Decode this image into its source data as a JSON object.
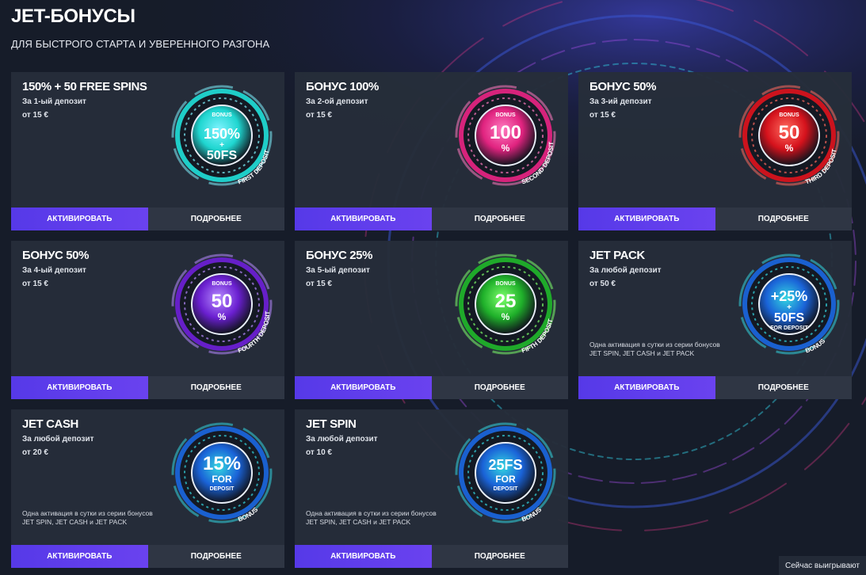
{
  "header": {
    "title": "JET-БОНУСЫ",
    "subtitle": "ДЛЯ БЫСТРОГО СТАРТА И УВЕРЕННОГО РАЗГОНА"
  },
  "cards": [
    {
      "title": "150% + 50 FREE SPINS",
      "deposit": "За 1-ый депозит",
      "min": "от 15 €",
      "note": "",
      "badge": {
        "top": "BONUS",
        "main": "150%",
        "plus": "+",
        "second": "50FS",
        "ring": "FIRST DEPOSIT",
        "color": "#1fd6d0",
        "glow": "#7ff3ff"
      },
      "activate": "АКТИВИРОВАТЬ",
      "more": "ПОДРОБНЕЕ"
    },
    {
      "title": "БОНУС 100%",
      "deposit": "За 2-ой депозит",
      "min": "от 15 €",
      "note": "",
      "badge": {
        "top": "BONUS",
        "main": "100",
        "second": "%",
        "ring": "SECOND DEPOSIT",
        "color": "#e0237f",
        "glow": "#ff7ac0"
      },
      "activate": "АКТИВИРОВАТЬ",
      "more": "ПОДРОБНЕЕ"
    },
    {
      "title": "БОНУС 50%",
      "deposit": "За 3-ий депозит",
      "min": "от 15 €",
      "note": "",
      "badge": {
        "top": "BONUS",
        "main": "50",
        "second": "%",
        "ring": "THIRD DEPOSIT",
        "color": "#d5121c",
        "glow": "#ff6a5e"
      },
      "activate": "АКТИВИРОВАТЬ",
      "more": "ПОДРОБНЕЕ"
    },
    {
      "title": "БОНУС 50%",
      "deposit": "За 4-ый депозит",
      "min": "от 15 €",
      "note": "",
      "badge": {
        "top": "BONUS",
        "main": "50",
        "second": "%",
        "ring": "FOURTH DEPOSIT",
        "color": "#6a1fd0",
        "glow": "#b68aff"
      },
      "activate": "АКТИВИРОВАТЬ",
      "more": "ПОДРОБНЕЕ"
    },
    {
      "title": "БОНУС 25%",
      "deposit": "За 5-ый депозит",
      "min": "от 15 €",
      "note": "",
      "badge": {
        "top": "BONUS",
        "main": "25",
        "second": "%",
        "ring": "FIFTH DEPOSIT",
        "color": "#1fb02a",
        "glow": "#7dff6b"
      },
      "activate": "АКТИВИРОВАТЬ",
      "more": "ПОДРОБНЕЕ"
    },
    {
      "title": "JET PACK",
      "deposit": "За любой депозит",
      "min": "от 50 €",
      "note": "Одна активация в сутки из серии бонусов JET SPIN, JET CASH и JET PACK",
      "badge": {
        "top": "",
        "main": "+25%",
        "plus": "+",
        "second": "50FS",
        "sub": "FOR DEPOSIT",
        "ring": "BONUS",
        "color": "#1a63d8",
        "glow": "#33d6e0"
      },
      "activate": "АКТИВИРОВАТЬ",
      "more": "ПОДРОБНЕЕ"
    },
    {
      "title": "JET CASH",
      "deposit": "За любой депозит",
      "min": "от 20 €",
      "note": "Одна активация в сутки из серии бонусов JET SPIN, JET CASH и JET PACK",
      "badge": {
        "top": "",
        "main": "15%",
        "second": "FOR",
        "sub": "DEPOSIT",
        "ring": "BONUS",
        "color": "#1a63d8",
        "glow": "#33d6e0"
      },
      "activate": "АКТИВИРОВАТЬ",
      "more": "ПОДРОБНЕЕ"
    },
    {
      "title": "JET SPIN",
      "deposit": "За любой депозит",
      "min": "от 10 €",
      "note": "Одна активация в сутки из серии бонусов JET SPIN, JET CASH и JET PACK",
      "badge": {
        "top": "",
        "main": "25FS",
        "second": "FOR",
        "sub": "DEPOSIT",
        "ring": "BONUS",
        "color": "#1a63d8",
        "glow": "#33d6e0"
      },
      "activate": "АКТИВИРОВАТЬ",
      "more": "ПОДРОБНЕЕ"
    }
  ],
  "status": {
    "label": "Сейчас выигрывают"
  }
}
